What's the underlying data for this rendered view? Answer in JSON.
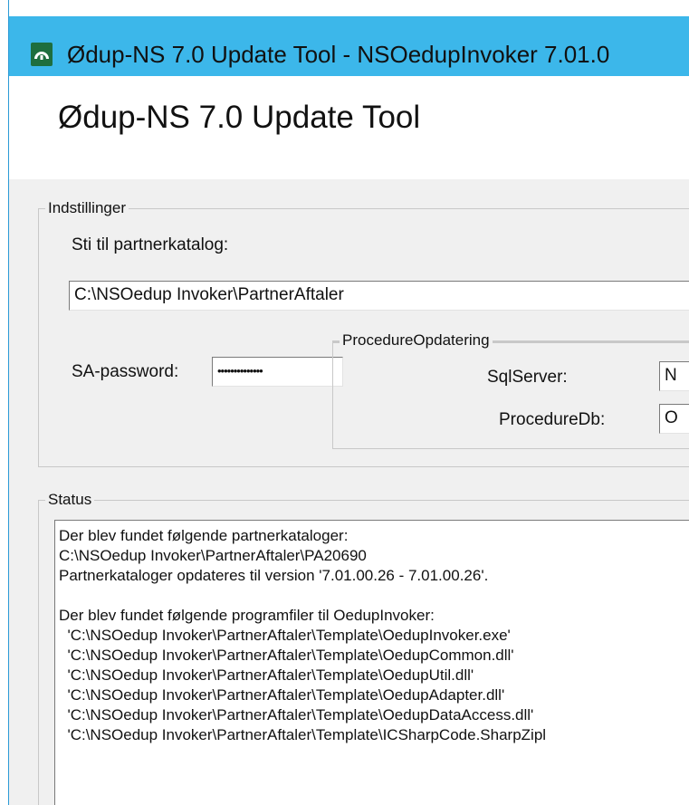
{
  "window": {
    "title": "Ødup-NS 7.0 Update Tool - NSOedupInvoker 7.01.0",
    "icon": "app-icon",
    "accent_color": "#3cb7ea"
  },
  "header": {
    "title": "Ødup-NS 7.0 Update Tool"
  },
  "settings": {
    "group_label": "Indstillinger",
    "partner_path_label": "Sti til partnerkatalog:",
    "partner_path_value": "C:\\NSOedup Invoker\\PartnerAftaler",
    "sa_password_label": "SA-password:",
    "sa_password_value": "••••••••••••••",
    "procedure": {
      "group_label": "ProcedureOpdatering",
      "sqlserver_label": "SqlServer:",
      "sqlserver_value": "N",
      "proceduredb_label": "ProcedureDb:",
      "proceduredb_value": "O"
    }
  },
  "status": {
    "group_label": "Status",
    "lines": [
      "Der blev fundet følgende partnerkataloger:",
      "C:\\NSOedup Invoker\\PartnerAftaler\\PA20690",
      "Partnerkataloger opdateres til version '7.01.00.26 - 7.01.00.26'.",
      "",
      "Der blev fundet følgende programfiler til OedupInvoker:",
      "  'C:\\NSOedup Invoker\\PartnerAftaler\\Template\\OedupInvoker.exe'",
      "  'C:\\NSOedup Invoker\\PartnerAftaler\\Template\\OedupCommon.dll'",
      "  'C:\\NSOedup Invoker\\PartnerAftaler\\Template\\OedupUtil.dll'",
      "  'C:\\NSOedup Invoker\\PartnerAftaler\\Template\\OedupAdapter.dll'",
      "  'C:\\NSOedup Invoker\\PartnerAftaler\\Template\\OedupDataAccess.dll'",
      "  'C:\\NSOedup Invoker\\PartnerAftaler\\Template\\ICSharpCode.SharpZipl"
    ]
  }
}
